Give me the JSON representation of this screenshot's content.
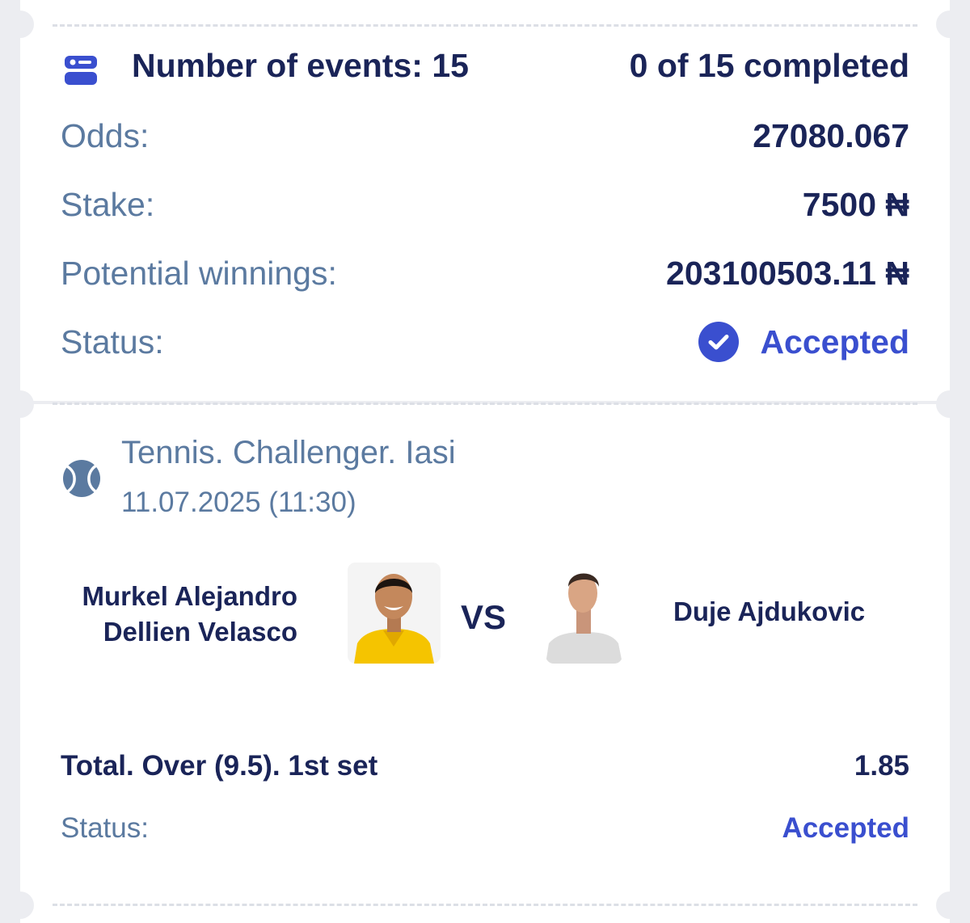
{
  "summary": {
    "events_label": "Number of events: 15",
    "completed": "0 of 15 completed",
    "odds_label": "Odds:",
    "odds_value": "27080.067",
    "stake_label": "Stake:",
    "stake_value": "7500 ₦",
    "winnings_label": "Potential winnings:",
    "winnings_value": "203100503.11 ₦",
    "status_label": "Status:",
    "status_value": "Accepted"
  },
  "event": {
    "tournament": "Tennis. Challenger. Iasi",
    "datetime": "11.07.2025 (11:30)",
    "player1_line1": "Murkel Alejandro",
    "player1_line2": "Dellien Velasco",
    "vs": "VS",
    "player2": "Duje Ajdukovic",
    "bet": "Total. Over (9.5). 1st set",
    "bet_odds": "1.85",
    "status_label": "Status:",
    "status_value": "Accepted"
  },
  "colors": {
    "navy": "#1a2458",
    "label": "#5b7aa0",
    "accent": "#3a4fcf",
    "background": "#ecedf1"
  },
  "icons": {
    "events": "events-list-icon",
    "status": "check-circle-icon",
    "sport": "tennis-ball-icon"
  }
}
